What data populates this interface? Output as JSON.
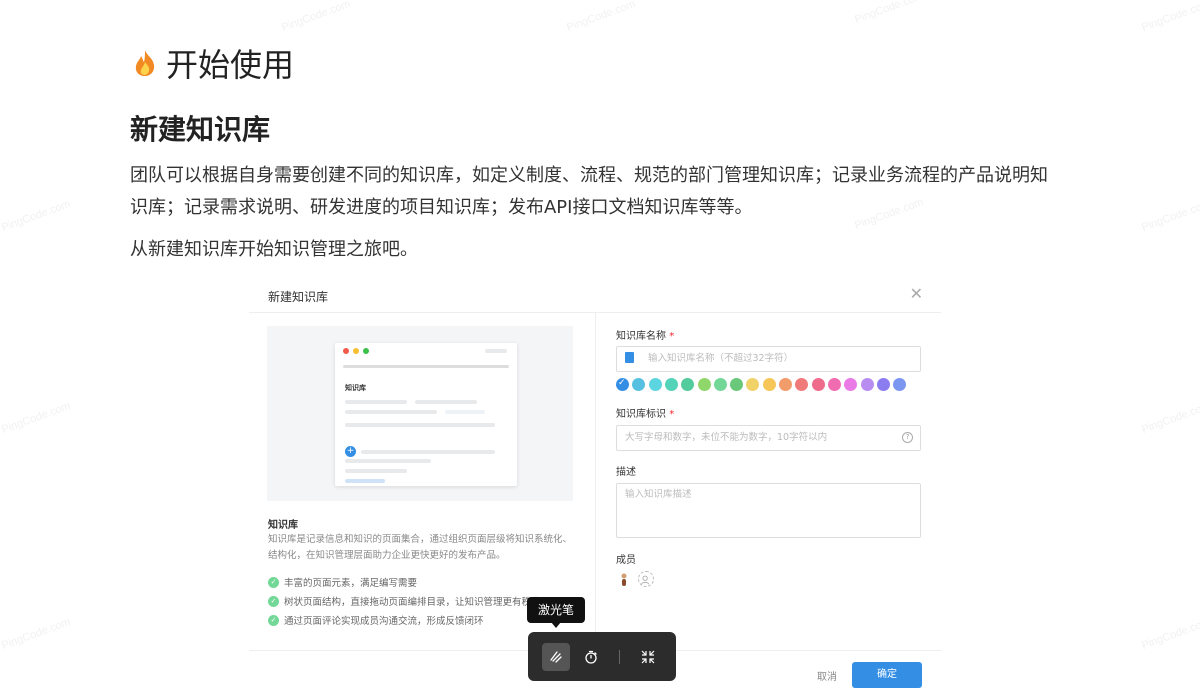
{
  "heading": "开始使用",
  "section_title": "新建知识库",
  "paragraphs": [
    "团队可以根据自身需要创建不同的知识库，如定义制度、流程、规范的部门管理知识库；记录业务流程的产品说明知识库；记录需求说明、研发进度的项目知识库；发布API接口文档知识库等等。",
    "从新建知识库开始知识管理之旅吧。"
  ],
  "watermark": "PingCode.com",
  "dialog": {
    "title": "新建知识库",
    "close_glyph": "✕",
    "preview": {
      "doc_title": "知识库",
      "plus_glyph": "+"
    },
    "info": {
      "title": "知识库",
      "description": "知识库是记录信息和知识的页面集合，通过组织页面层级将知识系统化、结构化，在知识管理层面助力企业更快更好的发布产品。",
      "features": [
        "丰富的页面元素，满足编写需要",
        "树状页面结构，直接拖动页面编排目录，让知识管理更有秩序",
        "通过页面评论实现成员沟通交流，形成反馈闭环"
      ]
    },
    "form": {
      "name_label": "知识库名称",
      "required_mark": "*",
      "name_placeholder": "输入知识库名称（不超过32字符）",
      "colors": [
        "#348fe4",
        "#56c0e0",
        "#5dd5e0",
        "#54d3b8",
        "#52cc9c",
        "#8fd76a",
        "#73d897",
        "#6ac87a",
        "#f1d268",
        "#f6c659",
        "#f29b6b",
        "#f07a7a",
        "#ee6b8b",
        "#f06bb0",
        "#e97ae6",
        "#b88cf0",
        "#8b7cf0",
        "#7b96f0"
      ],
      "identifier_label": "知识库标识",
      "identifier_placeholder": "大写字母和数字，未位不能为数字，10字符以内",
      "help_glyph": "?",
      "description_label": "描述",
      "description_placeholder": "输入知识库描述",
      "members_label": "成员"
    },
    "cancel_label": "取消",
    "confirm_label": "确定"
  },
  "tooltip": "激光笔",
  "toolbar": {
    "active_tool": "laser-pointer"
  }
}
